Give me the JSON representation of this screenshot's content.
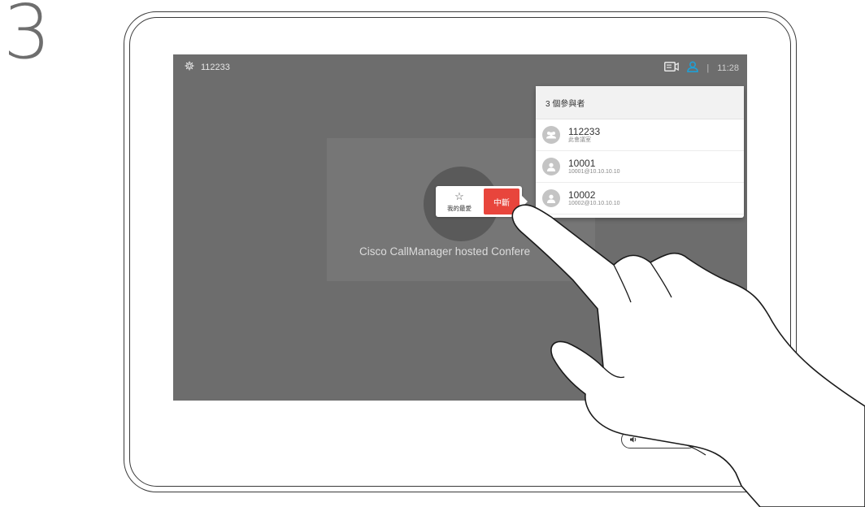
{
  "step": {
    "number": "3"
  },
  "topbar": {
    "call_id": "112233",
    "time": "11:28",
    "separator": "|",
    "icons": {
      "settings": "gear-icon",
      "selfview": "video-icon",
      "participants": "person-icon"
    }
  },
  "call": {
    "name": "Cisco CallManager hosted Confere"
  },
  "action_popup": {
    "favorite_label": "我的最愛",
    "end_label": "中斷",
    "favorite_icon": "star-icon"
  },
  "participants": {
    "header": "3 個參與者",
    "items": [
      {
        "name": "112233",
        "sub": "此會議室",
        "icon": "group-icon"
      },
      {
        "name": "10001",
        "sub": "10001@10.10.10.10",
        "icon": "person-icon"
      },
      {
        "name": "10002",
        "sub": "10002@10.10.10.10",
        "icon": "person-icon"
      }
    ]
  },
  "colors": {
    "screen_bg": "#6d6d6d",
    "end_button": "#e8453c",
    "accent_blue": "#1fa0d6",
    "device_outline": "#3a3a3a"
  },
  "volume": {
    "icon": "speaker-icon"
  }
}
